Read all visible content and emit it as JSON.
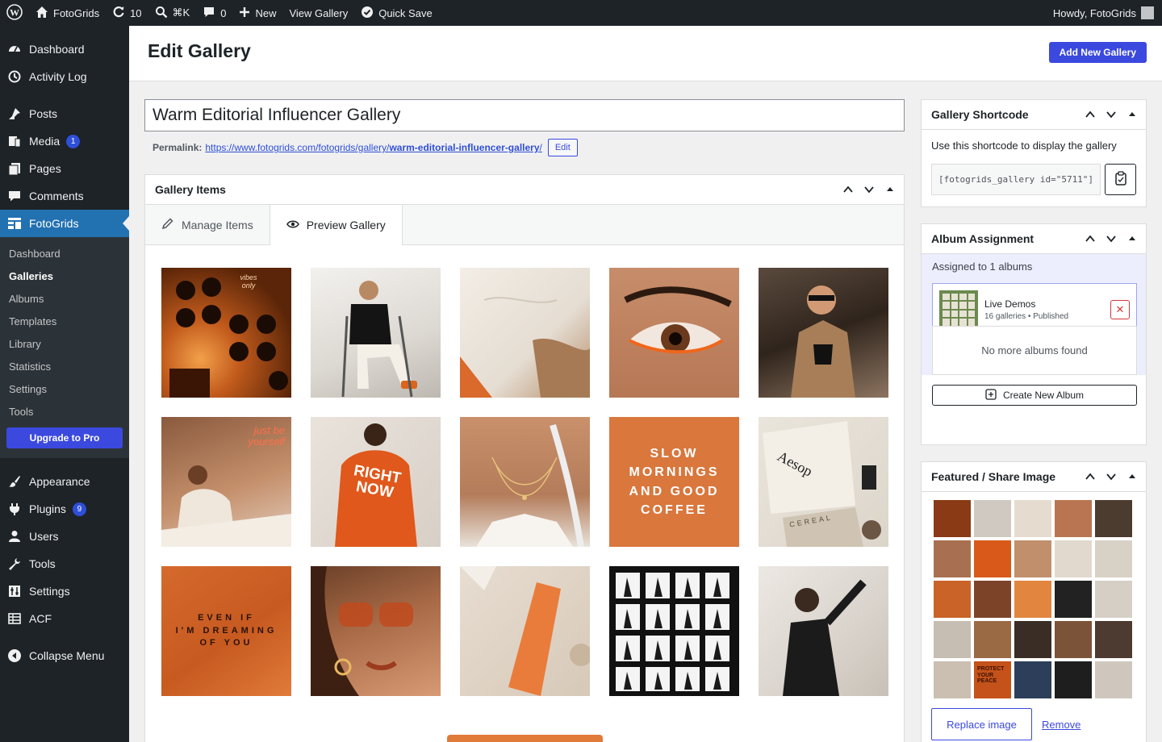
{
  "adminbar": {
    "site_name": "FotoGrids",
    "updates": "10",
    "search_shortcut": "⌘K",
    "comments": "0",
    "new": "New",
    "view_gallery": "View Gallery",
    "quick_save": "Quick Save",
    "howdy": "Howdy, FotoGrids"
  },
  "sidebar": {
    "dashboard": "Dashboard",
    "activity_log": "Activity Log",
    "posts": "Posts",
    "media": "Media",
    "media_badge": "1",
    "pages": "Pages",
    "comments": "Comments",
    "fotogrids": "FotoGrids",
    "sub": [
      "Dashboard",
      "Galleries",
      "Albums",
      "Templates",
      "Library",
      "Statistics",
      "Settings",
      "Tools"
    ],
    "upgrade": "Upgrade to Pro",
    "appearance": "Appearance",
    "plugins": "Plugins",
    "plugins_badge": "9",
    "users": "Users",
    "tools": "Tools",
    "settings": "Settings",
    "acf": "ACF",
    "collapse": "Collapse Menu"
  },
  "header": {
    "title": "Edit Gallery",
    "add_new": "Add New Gallery"
  },
  "post": {
    "title": "Warm Editorial Influencer Gallery",
    "permalink_label": "Permalink:",
    "permalink_base": "https://www.fotogrids.com/fotogrids/gallery/",
    "permalink_slug": "warm-editorial-influencer-gallery",
    "permalink_end": "/",
    "edit": "Edit"
  },
  "gallery_items": {
    "heading": "Gallery Items",
    "tabs": [
      "Manage Items",
      "Preview Gallery"
    ],
    "captions": {
      "slow": "SLOW\nMORNINGS\nAND GOOD\nCOFFEE",
      "dreaming": "EVEN IF\nI'M DREAMING\nOF YOU",
      "neon": "just be yourself",
      "right_now": "RIGHT NOW",
      "aesop": "Aesop",
      "cereal": "CEREAL",
      "vinyl": "vibes only"
    }
  },
  "shortcode": {
    "heading": "Gallery Shortcode",
    "description": "Use this shortcode to display the gallery",
    "value": "[fotogrids_gallery id=\"5711\"]"
  },
  "album": {
    "heading": "Album Assignment",
    "assigned": "Assigned to 1 albums",
    "name": "Live Demos",
    "meta": "16 galleries • Published",
    "no_more": "No more albums found",
    "create": "Create New Album"
  },
  "featured": {
    "heading": "Featured / Share Image",
    "replace": "Replace image",
    "remove": "Remove",
    "protect_text": "PROTECT YOUR PEACE"
  },
  "colors": {
    "accent": "#3b49df",
    "admin_dark": "#1d2327",
    "wp_blue": "#2271b1",
    "orange": "#e07b3a"
  }
}
